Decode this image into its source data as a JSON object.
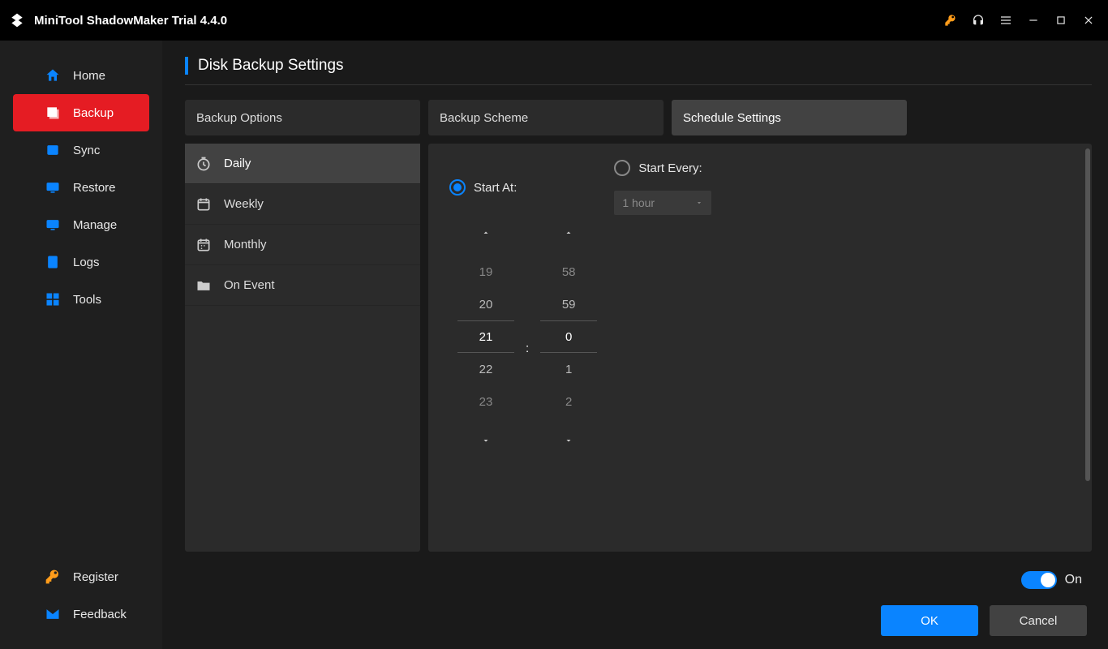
{
  "app_title": "MiniTool ShadowMaker Trial 4.4.0",
  "sidebar": {
    "items": [
      {
        "label": "Home"
      },
      {
        "label": "Backup"
      },
      {
        "label": "Sync"
      },
      {
        "label": "Restore"
      },
      {
        "label": "Manage"
      },
      {
        "label": "Logs"
      },
      {
        "label": "Tools"
      }
    ],
    "bottom": [
      {
        "label": "Register"
      },
      {
        "label": "Feedback"
      }
    ]
  },
  "page_title": "Disk Backup Settings",
  "tabs": [
    {
      "label": "Backup Options"
    },
    {
      "label": "Backup Scheme"
    },
    {
      "label": "Schedule Settings"
    }
  ],
  "freq": [
    {
      "label": "Daily"
    },
    {
      "label": "Weekly"
    },
    {
      "label": "Monthly"
    },
    {
      "label": "On Event"
    }
  ],
  "radios": {
    "start_at": "Start At:",
    "start_every": "Start Every:"
  },
  "start_every_value": "1 hour",
  "time": {
    "hours": [
      "19",
      "20",
      "21",
      "22",
      "23"
    ],
    "minutes": [
      "58",
      "59",
      "0",
      "1",
      "2"
    ],
    "colon": ":"
  },
  "toggle_label": "On",
  "buttons": {
    "ok": "OK",
    "cancel": "Cancel"
  }
}
